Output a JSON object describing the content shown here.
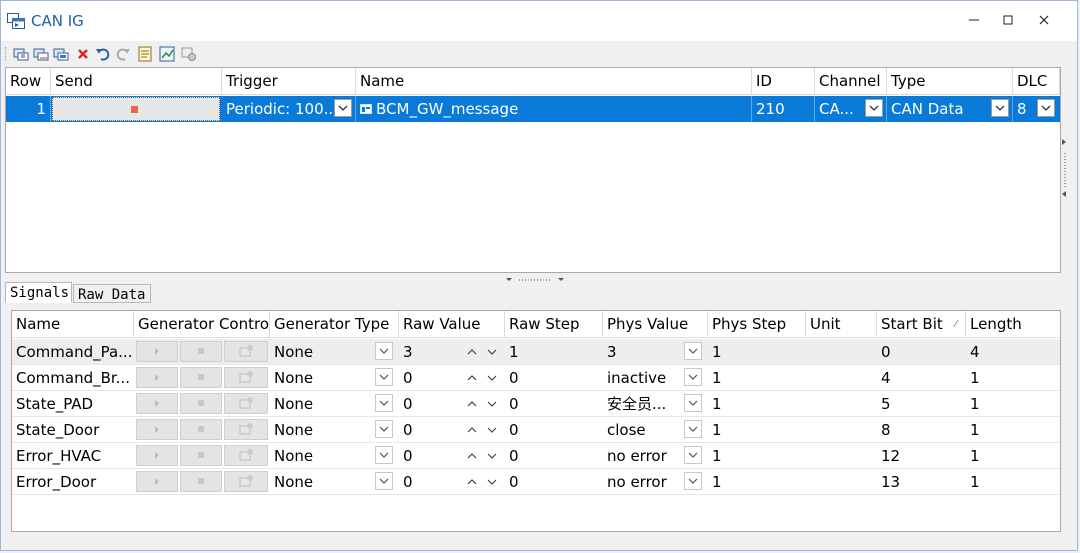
{
  "window": {
    "title": "CAN IG"
  },
  "messages": {
    "columns": [
      "Row",
      "Send",
      "Trigger",
      "Name",
      "ID",
      "Channel",
      "Type",
      "DLC"
    ],
    "rows": [
      {
        "row": "1",
        "trigger": "Periodic: 100...",
        "name": "BCM_GW_message",
        "id": "210",
        "channel": "CA...",
        "type": "CAN Data",
        "dlc": "8"
      }
    ]
  },
  "tabs": [
    "Signals",
    "Raw Data"
  ],
  "signals": {
    "columns": [
      "Name",
      "Generator Control",
      "Generator Type",
      "Raw Value",
      "Raw Step",
      "Phys Value",
      "Phys Step",
      "Unit",
      "Start Bit",
      "Length"
    ],
    "rows": [
      {
        "name": "Command_Pa...",
        "gen_type": "None",
        "raw_value": "3",
        "raw_step": "1",
        "phys_value": "3",
        "phys_step": "1",
        "unit": "",
        "start_bit": "0",
        "length": "4"
      },
      {
        "name": "Command_Br...",
        "gen_type": "None",
        "raw_value": "0",
        "raw_step": "0",
        "phys_value": "inactive",
        "phys_step": "1",
        "unit": "",
        "start_bit": "4",
        "length": "1"
      },
      {
        "name": "State_PAD",
        "gen_type": "None",
        "raw_value": "0",
        "raw_step": "0",
        "phys_value": "安全员...",
        "phys_step": "1",
        "unit": "",
        "start_bit": "5",
        "length": "1"
      },
      {
        "name": "State_Door",
        "gen_type": "None",
        "raw_value": "0",
        "raw_step": "0",
        "phys_value": "close",
        "phys_step": "1",
        "unit": "",
        "start_bit": "8",
        "length": "1"
      },
      {
        "name": "Error_HVAC",
        "gen_type": "None",
        "raw_value": "0",
        "raw_step": "0",
        "phys_value": "no error",
        "phys_step": "1",
        "unit": "",
        "start_bit": "12",
        "length": "1"
      },
      {
        "name": "Error_Door",
        "gen_type": "None",
        "raw_value": "0",
        "raw_step": "0",
        "phys_value": "no error",
        "phys_step": "1",
        "unit": "",
        "start_bit": "13",
        "length": "1"
      }
    ]
  },
  "colors": {
    "selection": "#0a7ad8",
    "title": "#1f5fa8"
  }
}
